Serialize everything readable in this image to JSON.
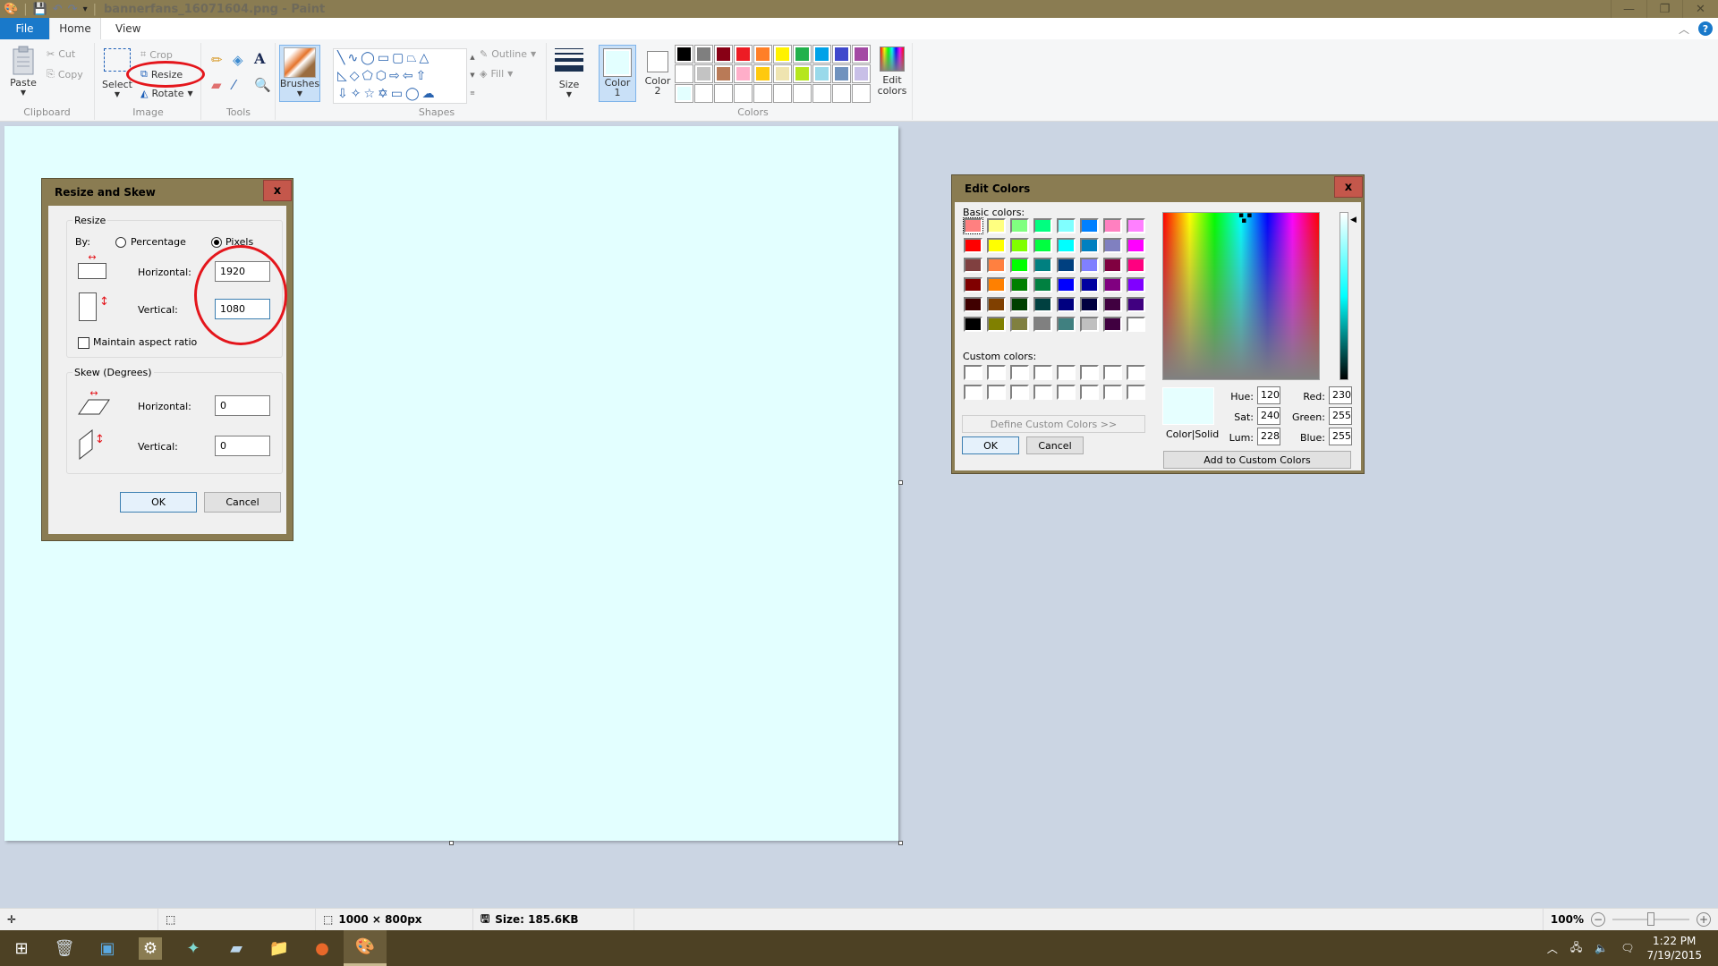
{
  "window": {
    "title": "bannerfans_16071604.png - Paint",
    "minimize": "—",
    "restore": "❐",
    "close": "✕"
  },
  "tabs": [
    {
      "label": "File"
    },
    {
      "label": "Home"
    },
    {
      "label": "View"
    }
  ],
  "help_label": "?",
  "ribbon": {
    "clipboard": {
      "paste": "Paste",
      "cut": "Cut",
      "copy": "Copy",
      "label": "Clipboard"
    },
    "image": {
      "select": "Select",
      "crop": "Crop",
      "resize": "Resize",
      "rotate": "Rotate",
      "label": "Image"
    },
    "tools": {
      "label": "Tools"
    },
    "brushes": {
      "label": "Brushes"
    },
    "shapes": {
      "outline": "Outline",
      "fill": "Fill",
      "label": "Shapes"
    },
    "size": {
      "label": "Size"
    },
    "color1": {
      "label": "Color",
      "num": "1",
      "color": "#e3ffff"
    },
    "color2": {
      "label": "Color",
      "num": "2",
      "color": "#ffffff"
    },
    "colors": {
      "label": "Colors",
      "edit_label_1": "Edit",
      "edit_label_2": "colors",
      "palette_row1": [
        "#000000",
        "#7f7f7f",
        "#880015",
        "#ed1c24",
        "#ff7f27",
        "#fff200",
        "#22b14c",
        "#00a2e8",
        "#3f48cc",
        "#a349a4"
      ],
      "palette_row2": [
        "#ffffff",
        "#c3c3c3",
        "#b97a57",
        "#ffaec9",
        "#ffc90e",
        "#efe4b0",
        "#b5e61d",
        "#99d9ea",
        "#7092be",
        "#c8bfe7"
      ],
      "palette_row3": [
        "#e3ffff",
        "",
        "",
        "",
        "",
        "",
        "",
        "",
        "",
        ""
      ]
    }
  },
  "resize_dialog": {
    "title": "Resize and Skew",
    "close": "x",
    "resize_group": "Resize",
    "by_label": "By:",
    "percentage_label": "Percentage",
    "pixels_label": "Pixels",
    "selected_mode": "Pixels",
    "horizontal_label": "Horizontal:",
    "horizontal_value": "1920",
    "vertical_label": "Vertical:",
    "vertical_value": "1080",
    "maintain_aspect": "Maintain aspect ratio",
    "maintain_aspect_checked": false,
    "skew_group": "Skew (Degrees)",
    "skew_horizontal_label": "Horizontal:",
    "skew_horizontal_value": "0",
    "skew_vertical_label": "Vertical:",
    "skew_vertical_value": "0",
    "ok": "OK",
    "cancel": "Cancel"
  },
  "edit_colors_dialog": {
    "title": "Edit Colors",
    "close": "x",
    "basic_colors_label": "Basic colors:",
    "basic_colors": [
      [
        "#ff8080",
        "#ffff80",
        "#80ff80",
        "#00ff80",
        "#80ffff",
        "#0080ff",
        "#ff80c0",
        "#ff80ff"
      ],
      [
        "#ff0000",
        "#ffff00",
        "#80ff00",
        "#00ff40",
        "#00ffff",
        "#0080c0",
        "#8080c0",
        "#ff00ff"
      ],
      [
        "#804040",
        "#ff8040",
        "#00ff00",
        "#008080",
        "#004080",
        "#8080ff",
        "#800040",
        "#ff0080"
      ],
      [
        "#800000",
        "#ff8000",
        "#008000",
        "#008040",
        "#0000ff",
        "#0000a0",
        "#800080",
        "#8000ff"
      ],
      [
        "#400000",
        "#804000",
        "#004000",
        "#004040",
        "#000080",
        "#000040",
        "#400040",
        "#400080"
      ],
      [
        "#000000",
        "#808000",
        "#808040",
        "#808080",
        "#408080",
        "#c0c0c0",
        "#400040",
        "#ffffff"
      ]
    ],
    "custom_colors_label": "Custom colors:",
    "define_custom": "Define Custom Colors >>",
    "ok": "OK",
    "cancel": "Cancel",
    "color_solid_label": "Color|Solid",
    "preview_color": "#e6ffff",
    "hue_label": "Hue:",
    "hue": "120",
    "sat_label": "Sat:",
    "sat": "240",
    "lum_label": "Lum:",
    "lum": "228",
    "red_label": "Red:",
    "red": "230",
    "green_label": "Green:",
    "green": "255",
    "blue_label": "Blue:",
    "blue": "255",
    "add_custom": "Add to Custom Colors"
  },
  "statusbar": {
    "dimensions": "1000 × 800px",
    "size": "Size: 185.6KB",
    "zoom": "100%",
    "zoom_level_percent": 100
  },
  "taskbar": {
    "time": "1:22 PM",
    "date": "7/19/2015"
  }
}
